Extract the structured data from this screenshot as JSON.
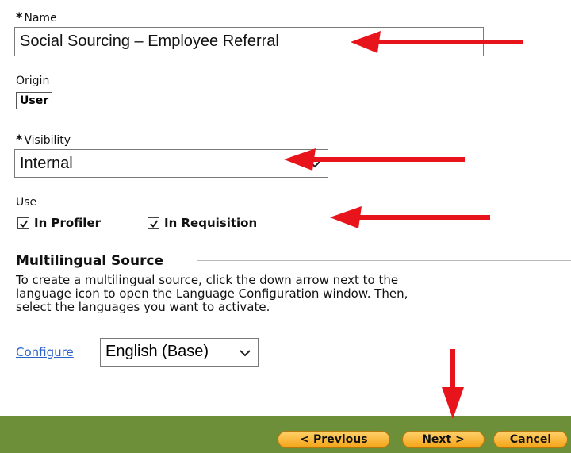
{
  "name_field": {
    "label": "Name",
    "required_mark": "*",
    "value": "Social Sourcing – Employee Referral"
  },
  "origin": {
    "label": "Origin",
    "value": "User"
  },
  "visibility": {
    "label": "Visibility",
    "required_mark": "*",
    "value": "Internal"
  },
  "use": {
    "label": "Use",
    "options": [
      {
        "label": "In Profiler",
        "checked": true
      },
      {
        "label": "In Requisition",
        "checked": true
      }
    ]
  },
  "multilingual": {
    "title": "Multilingual Source",
    "help_lines": [
      "To create a multilingual source, click the down arrow next to the",
      "language icon to open the Language Configuration window. Then,",
      "select the languages you want to activate."
    ],
    "configure_link": "Configure",
    "language_value": "English (Base)"
  },
  "footer": {
    "previous_label": "< Previous",
    "next_label": "Next >",
    "cancel_label": "Cancel",
    "bar_color": "#6e8f3a"
  },
  "annotation_color": "#e8141c"
}
